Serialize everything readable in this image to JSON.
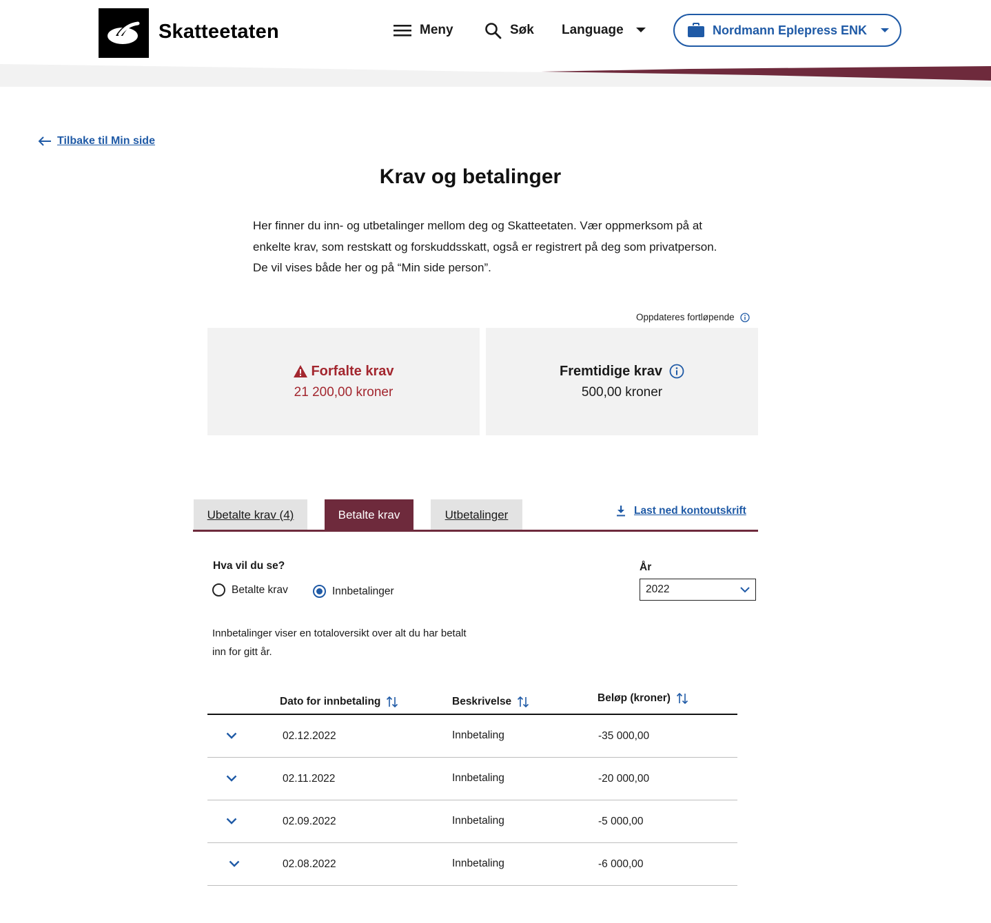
{
  "header": {
    "logo_text": "Skatteetaten",
    "menu_label": "Meny",
    "search_label": "Søk",
    "language_label": "Language",
    "organization_label": "Nordmann Eplepress ENK"
  },
  "colors": {
    "accent_blue": "#1f5aa6",
    "brand_burgundy": "#6e2a3c",
    "alert_red": "#a3272f",
    "card_gray": "#f2f2f2"
  },
  "back_link": "Tilbake til Min side",
  "page": {
    "title": "Krav og betalinger",
    "intro": "Her finner du inn- og utbetalinger mellom deg og Skatteetaten. Vær oppmerksom på at enkelte krav, som restskatt og forskuddsskatt, også er registrert på deg som privatperson. De vil vises både her og på “Min side person”.",
    "updated_note": "Oppdateres fortløpende"
  },
  "cards": {
    "overdue": {
      "title": "Forfalte krav",
      "amount": "21 200,00 kroner"
    },
    "future": {
      "title": "Fremtidige krav",
      "amount": "500,00 kroner"
    }
  },
  "tabs": {
    "unpaid": "Ubetalte krav (4)",
    "paid": "Betalte krav",
    "payouts": "Utbetalinger",
    "active": "paid"
  },
  "download_label": "Last ned kontoutskrift",
  "filter": {
    "question": "Hva vil du se?",
    "option_paid_claims": "Betalte krav",
    "option_payments": "Innbetalinger",
    "selected": "Innbetalinger",
    "year_label": "År",
    "year_value": "2022"
  },
  "info_text": "Innbetalinger viser en totaloversikt over alt du har betalt inn for gitt år.",
  "table": {
    "headers": {
      "date": "Dato for innbetaling",
      "description": "Beskrivelse",
      "amount": "Beløp (kroner)"
    },
    "rows": [
      {
        "date": "02.12.2022",
        "description": "Innbetaling",
        "amount": "-35 000,00"
      },
      {
        "date": "02.11.2022",
        "description": "Innbetaling",
        "amount": "-20 000,00"
      },
      {
        "date": "02.09.2022",
        "description": "Innbetaling",
        "amount": "-5 000,00"
      },
      {
        "date": "02.08.2022",
        "description": "Innbetaling",
        "amount": "-6 000,00"
      }
    ]
  },
  "icons": {
    "logo": "skatteetaten-logo-icon",
    "menu": "hamburger-icon",
    "search": "search-icon",
    "language": "caret-down-icon",
    "organization": "briefcase-icon",
    "back": "arrow-left-icon",
    "warning": "warning-triangle-icon",
    "info": "info-circle-icon",
    "download": "download-icon",
    "sort": "sort-arrows-icon",
    "expand": "chevron-down-icon"
  }
}
